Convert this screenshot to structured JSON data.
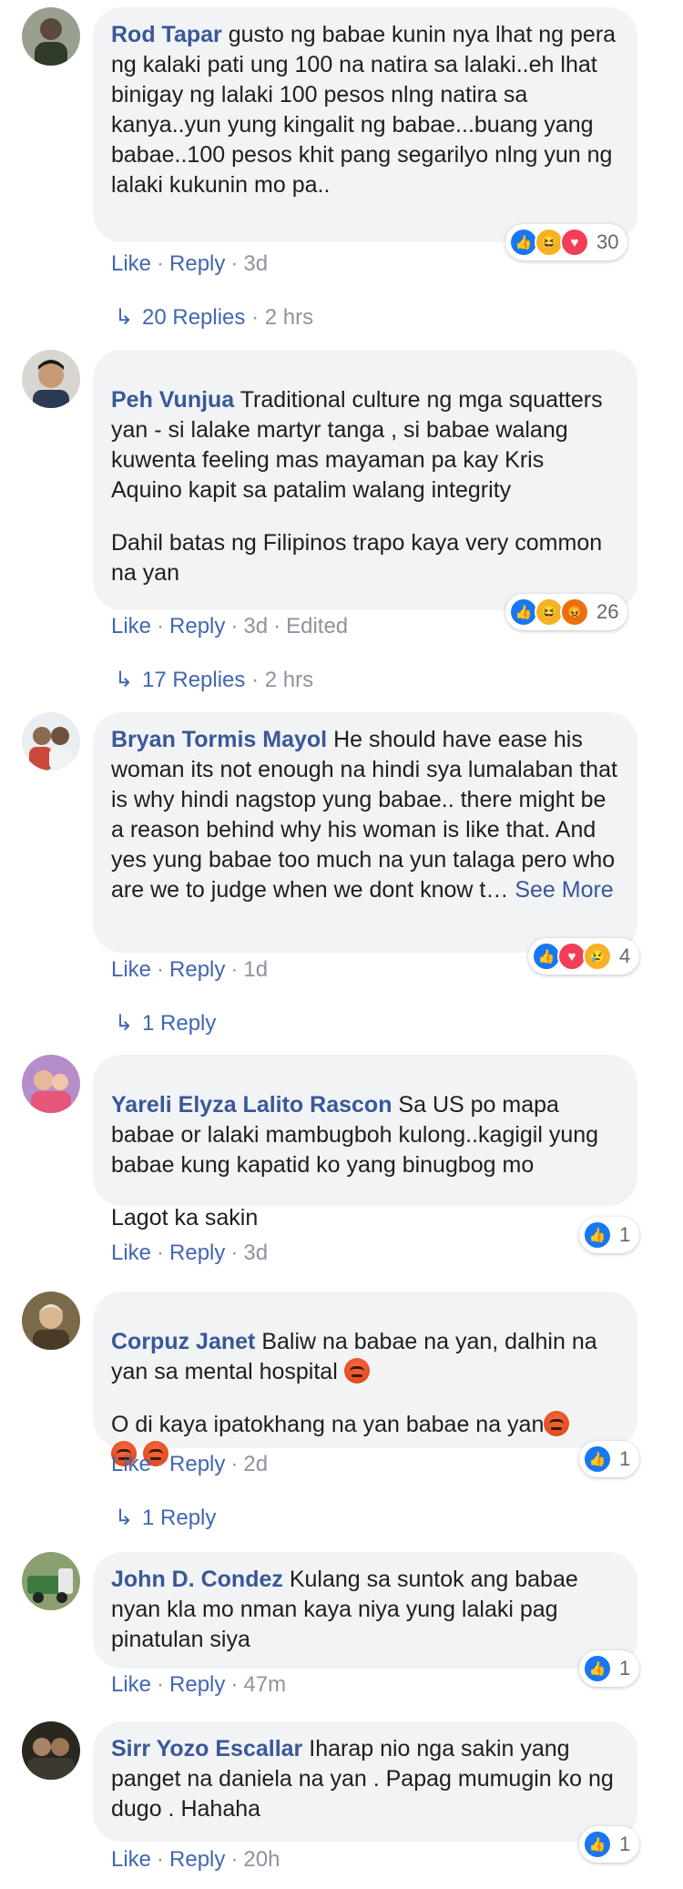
{
  "labels": {
    "like": "Like",
    "reply": "Reply",
    "dot": "·",
    "edited": "Edited",
    "see_more": "See More"
  },
  "comments": [
    {
      "author": "Rod Tapar",
      "text": "gusto ng babae kunin nya lhat ng pera ng kalaki pati ung 100 na natira sa lalaki..eh lhat binigay ng lalaki 100 pesos nlng natira sa kanya..yun yung kingalit ng babae...buang yang babae..100 pesos khit pang segarilyo nlng yun ng lalaki kukunin mo pa..",
      "time": "3d",
      "reactions": [
        "like-icon",
        "haha-icon",
        "love-icon"
      ],
      "reaction_count": "30",
      "replies": "20 Replies",
      "replies_time": "2 hrs"
    },
    {
      "author": "Peh Vunjua",
      "text": "Traditional culture ng mga squatters yan - si lalake martyr tanga , si babae walang kuwenta feeling mas mayaman pa kay Kris Aquino kapit sa patalim walang integrity",
      "text2": "Dahil batas ng Filipinos trapo kaya very common na yan",
      "time": "3d",
      "edited": true,
      "reactions": [
        "like-icon",
        "haha-icon",
        "angry-icon"
      ],
      "reaction_count": "26",
      "replies": "17 Replies",
      "replies_time": "2 hrs"
    },
    {
      "author": "Bryan Tormis Mayol",
      "text": "He should have ease his woman its not enough na hindi sya lumalaban that is why hindi nagstop yung babae.. there might be a reason behind why his woman is like that. And yes yung babae too much na yun talaga pero who are we to judge when we dont know t…",
      "time": "1d",
      "reactions": [
        "like-icon",
        "love-icon",
        "sad-icon"
      ],
      "reaction_count": "4",
      "replies": "1 Reply"
    },
    {
      "author": "Yareli Elyza Lalito Rascon",
      "text": "Sa US po mapa babae or lalaki mambugboh kulong..kagigil yung babae kung kapatid ko yang binugbog mo",
      "text2": "Lagot ka sakin",
      "time": "3d",
      "reactions": [
        "like-icon"
      ],
      "reaction_count": "1"
    },
    {
      "author": "Corpuz Janet",
      "text": "Baliw na babae na yan, dalhin na yan sa mental hospital",
      "text2": "O di kaya ipatokhang na yan babae na yan",
      "time": "2d",
      "reactions": [
        "like-icon"
      ],
      "reaction_count": "1",
      "replies": "1 Reply"
    },
    {
      "author": "John D. Condez",
      "text": "Kulang sa suntok ang babae nyan kla mo nman kaya niya yung lalaki pag pinatulan siya",
      "time": "47m",
      "reactions": [
        "like-icon"
      ],
      "reaction_count": "1"
    },
    {
      "author": "Sirr Yozo Escallar",
      "text": "Iharap nio nga sakin yang panget na daniela na yan . Papag mumugin ko ng dugo . Hahaha",
      "time": "20h",
      "reactions": [
        "like-icon"
      ],
      "reaction_count": "1"
    }
  ]
}
